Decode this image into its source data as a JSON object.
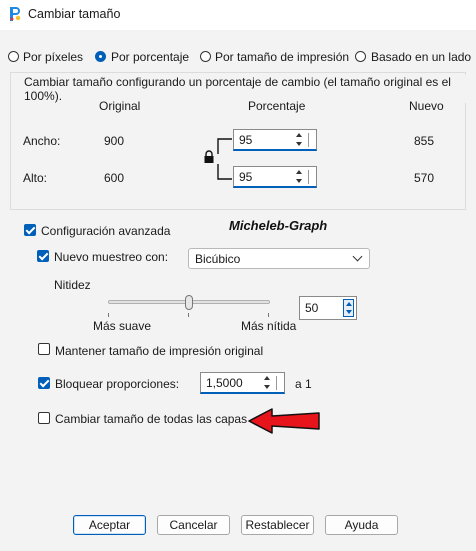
{
  "window": {
    "title": "Cambiar tamaño"
  },
  "mode": {
    "options": [
      "Por píxeles",
      "Por porcentaje",
      "Por tamaño de impresión",
      "Basado en un lado"
    ],
    "selected": "Por porcentaje"
  },
  "group": {
    "title": "Cambiar tamaño configurando un porcentaje de cambio (el tamaño original es el 100%).",
    "col_original": "Original",
    "col_percent": "Porcentaje",
    "col_new": "Nuevo",
    "width": {
      "label": "Ancho:",
      "original": "900",
      "percent": "95",
      "new": "855"
    },
    "height": {
      "label": "Alto:",
      "original": "600",
      "percent": "95",
      "new": "570"
    }
  },
  "advanced": {
    "label": "Configuración avanzada",
    "checked": true,
    "resample_label": "Nuevo muestreo con:",
    "resample_checked": true,
    "resample_value": "Bicúbico",
    "sharpness_label": "Nitidez",
    "sharpness_value": "50",
    "sharpness_fraction": 0.5,
    "slider_left": "Más suave",
    "slider_right": "Más nítida",
    "keep_print_label": "Mantener tamaño de impresión original",
    "keep_print_checked": false,
    "lock_ratio_label": "Bloquear proporciones:",
    "lock_ratio_checked": true,
    "ratio_value": "1,5000",
    "ratio_suffix": "a 1",
    "all_layers_label": "Cambiar tamaño de todas las capas",
    "all_layers_checked": false
  },
  "watermark": "Micheleb-Graph",
  "buttons": {
    "ok": "Aceptar",
    "cancel": "Cancelar",
    "reset": "Restablecer",
    "help": "Ayuda"
  },
  "colors": {
    "accent": "#005fb8",
    "arrow": "#e8141b"
  }
}
